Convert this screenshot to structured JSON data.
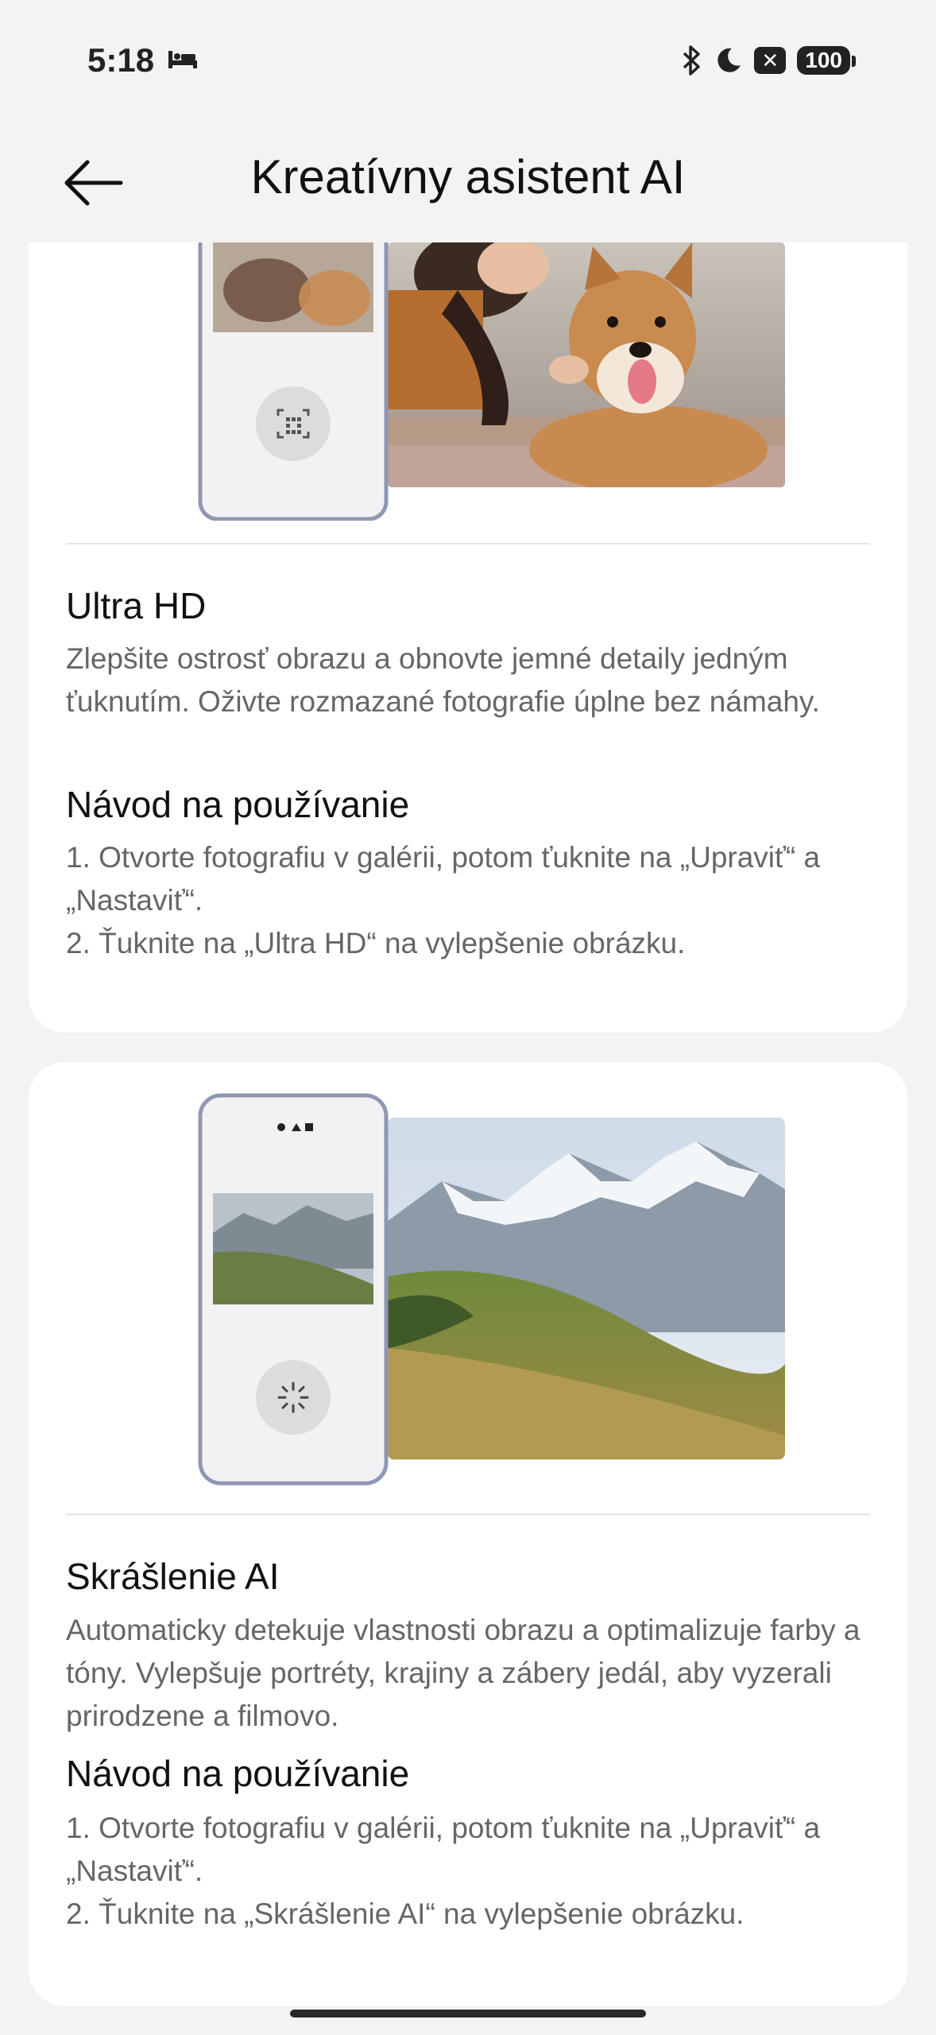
{
  "status": {
    "time": "5:18",
    "battery": "100"
  },
  "header": {
    "title": "Kreatívny asistent AI"
  },
  "cards": [
    {
      "feature_title": "Ultra HD",
      "feature_desc": "Zlepšite ostrosť obrazu a obnovte jemné detaily jedným ťuknutím. Oživte rozmazané fotografie úplne bez námahy.",
      "guide_title": "Návod na používanie",
      "guide_step1": "1. Otvorte fotografiu v galérii, potom ťuknite na „Upraviť“ a „Nastaviť“.",
      "guide_step2": "2. Ťuknite na „Ultra HD“ na vylepšenie obrázku."
    },
    {
      "feature_title": "Skrášlenie AI",
      "feature_desc": "Automaticky detekuje vlastnosti obrazu a optimalizuje farby a tóny. Vylepšuje portréty, krajiny a zábery jedál, aby vyzerali prirodzene a filmovo.",
      "guide_title": "Návod na používanie",
      "guide_step1": "1. Otvorte fotografiu v galérii, potom ťuknite na „Upraviť“ a „Nastaviť“.",
      "guide_step2": "2. Ťuknite na „Skrášlenie AI“ na vylepšenie obrázku."
    }
  ]
}
